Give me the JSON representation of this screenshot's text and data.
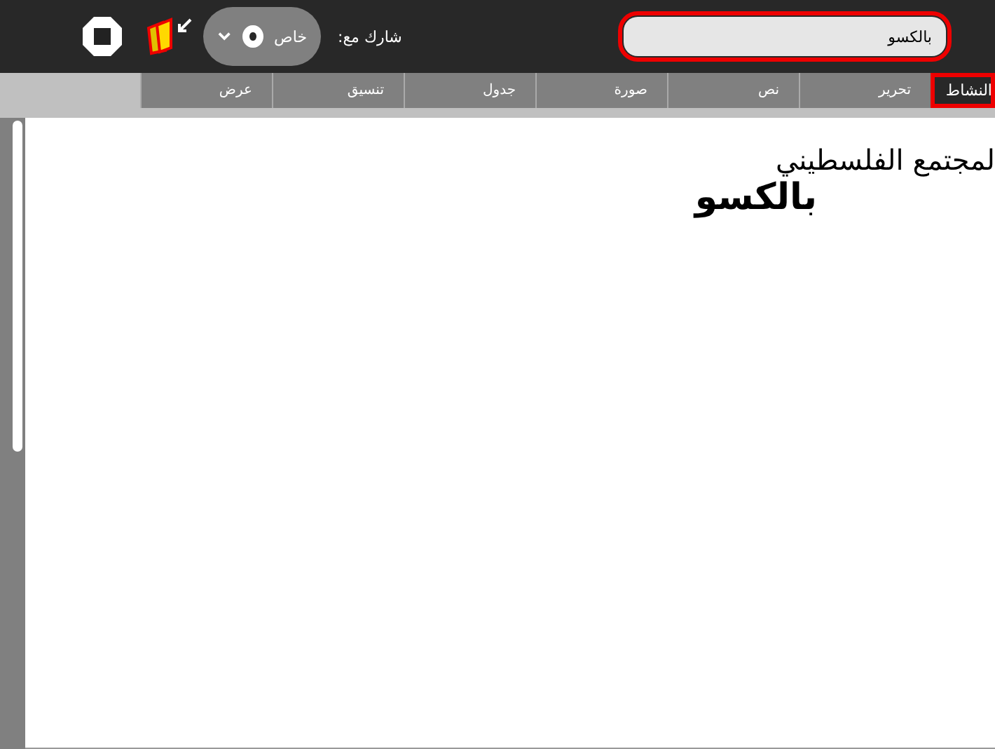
{
  "toolbar": {
    "share_label": "شارك مع:",
    "share": {
      "value": "خاص",
      "selected": true
    },
    "title": {
      "value": "بالكسو",
      "highlighted": true
    }
  },
  "tabs": [
    {
      "label": "النشاط",
      "selected": true,
      "highlighted": true
    },
    {
      "label": "تحرير",
      "selected": false,
      "highlighted": false
    },
    {
      "label": "نص",
      "selected": false,
      "highlighted": false
    },
    {
      "label": "صورة",
      "selected": false,
      "highlighted": false
    },
    {
      "label": "جدول",
      "selected": false,
      "highlighted": false
    },
    {
      "label": "تنسيق",
      "selected": false,
      "highlighted": false
    },
    {
      "label": "عرض",
      "selected": false,
      "highlighted": false
    }
  ],
  "document": {
    "paragraphs": [
      {
        "kind": "normal",
        "text": "لمجتمع الفلسطيني"
      },
      {
        "kind": "bold",
        "text": "بالكسو"
      }
    ]
  }
}
